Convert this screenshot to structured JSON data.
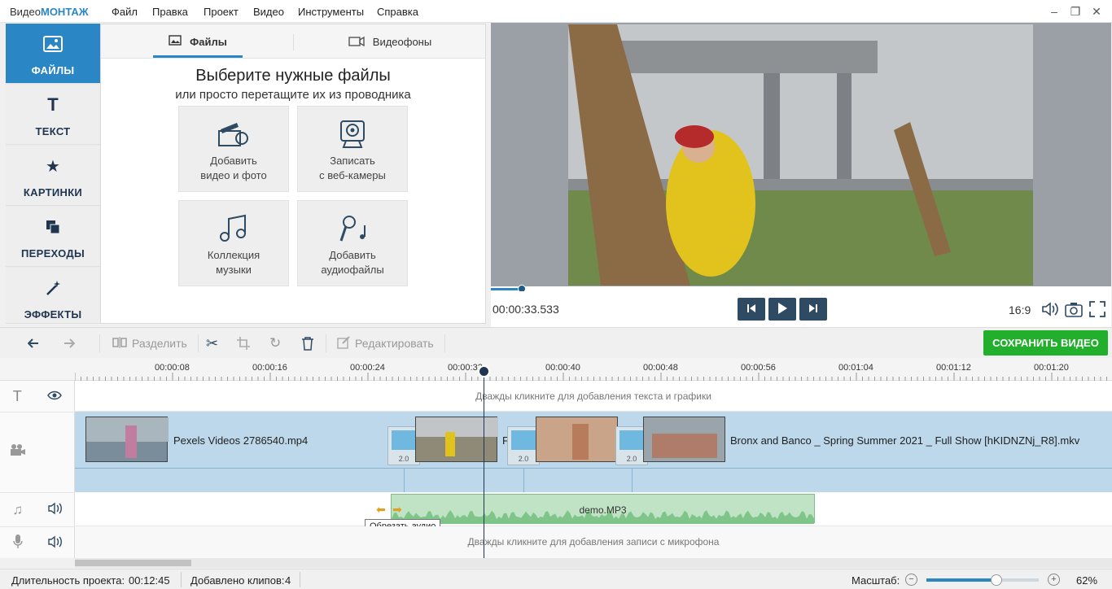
{
  "app": {
    "logo_prefix": "Видео",
    "logo_suffix": "МОНТАЖ"
  },
  "menu": [
    "Файл",
    "Правка",
    "Проект",
    "Видео",
    "Инструменты",
    "Справка"
  ],
  "window_controls": [
    "minimize-icon",
    "restore-icon",
    "close-icon"
  ],
  "sidebar": {
    "items": [
      {
        "label": "ФАЙЛЫ",
        "icon": "image-icon",
        "active": true
      },
      {
        "label": "ТЕКСТ",
        "icon": "text-icon"
      },
      {
        "label": "КАРТИНКИ",
        "icon": "star-icon"
      },
      {
        "label": "ПЕРЕХОДЫ",
        "icon": "transitions-icon"
      },
      {
        "label": "ЭФФЕКТЫ",
        "icon": "magic-wand-icon"
      }
    ]
  },
  "files_panel": {
    "tabs": [
      {
        "label": "Файлы",
        "icon": "image-icon",
        "active": true
      },
      {
        "label": "Видеофоны",
        "icon": "video-camera-icon"
      }
    ],
    "heading": "Выберите нужные файлы",
    "subheading": "или просто перетащите их из проводника",
    "tiles": [
      {
        "line1": "Добавить",
        "line2": "видео и фото",
        "icon": "film-camera-icon"
      },
      {
        "line1": "Записать",
        "line2": "с веб-камеры",
        "icon": "webcam-icon"
      },
      {
        "line1": "Коллекция",
        "line2": "музыки",
        "icon": "music-notes-icon"
      },
      {
        "line1": "Добавить",
        "line2": "аудиофайлы",
        "icon": "microphone-icon"
      }
    ]
  },
  "player": {
    "timecode": "00:00:33.533",
    "progress_fraction": 0.05,
    "aspect": "16:9",
    "buttons": [
      "prev-icon",
      "play-icon",
      "next-icon"
    ]
  },
  "toolbar": {
    "split": "Разделить",
    "edit": "Редактировать",
    "save": "СОХРАНИТЬ ВИДЕО"
  },
  "timeline": {
    "ruler_ticks": [
      "00:00:08",
      "00:00:16",
      "00:00:24",
      "00:00:32",
      "00:00:40",
      "00:00:48",
      "00:00:56",
      "00:01:04",
      "00:01:12",
      "00:01:20"
    ],
    "text_hint": "Дважды кликните для добавления текста и графики",
    "clips": [
      {
        "name": "Pexels Videos 2786540.mp4"
      },
      {
        "name": "F"
      },
      {
        "name": "Bronx and Banco _ Spring Summer 2021 _ Full Show [hKIDNZNj_R8].mkv"
      }
    ],
    "transition_duration": "2.0",
    "audio_clip": "demo.MP3",
    "tooltip": "Обрезать аудио",
    "mic_hint": "Дважды кликните для добавления записи с микрофона"
  },
  "status": {
    "duration_label": "Длительность проекта:",
    "duration_value": "00:12:45",
    "clips_label": "Добавлено клипов:",
    "clips_value": "4",
    "zoom_label": "Масштаб:",
    "zoom_value": "62%",
    "zoom_fraction": 0.62
  },
  "colors": {
    "accent": "#2b86c5",
    "save": "#22b02c",
    "track": "#bcd8ea",
    "audio": "#bfe3c4"
  }
}
